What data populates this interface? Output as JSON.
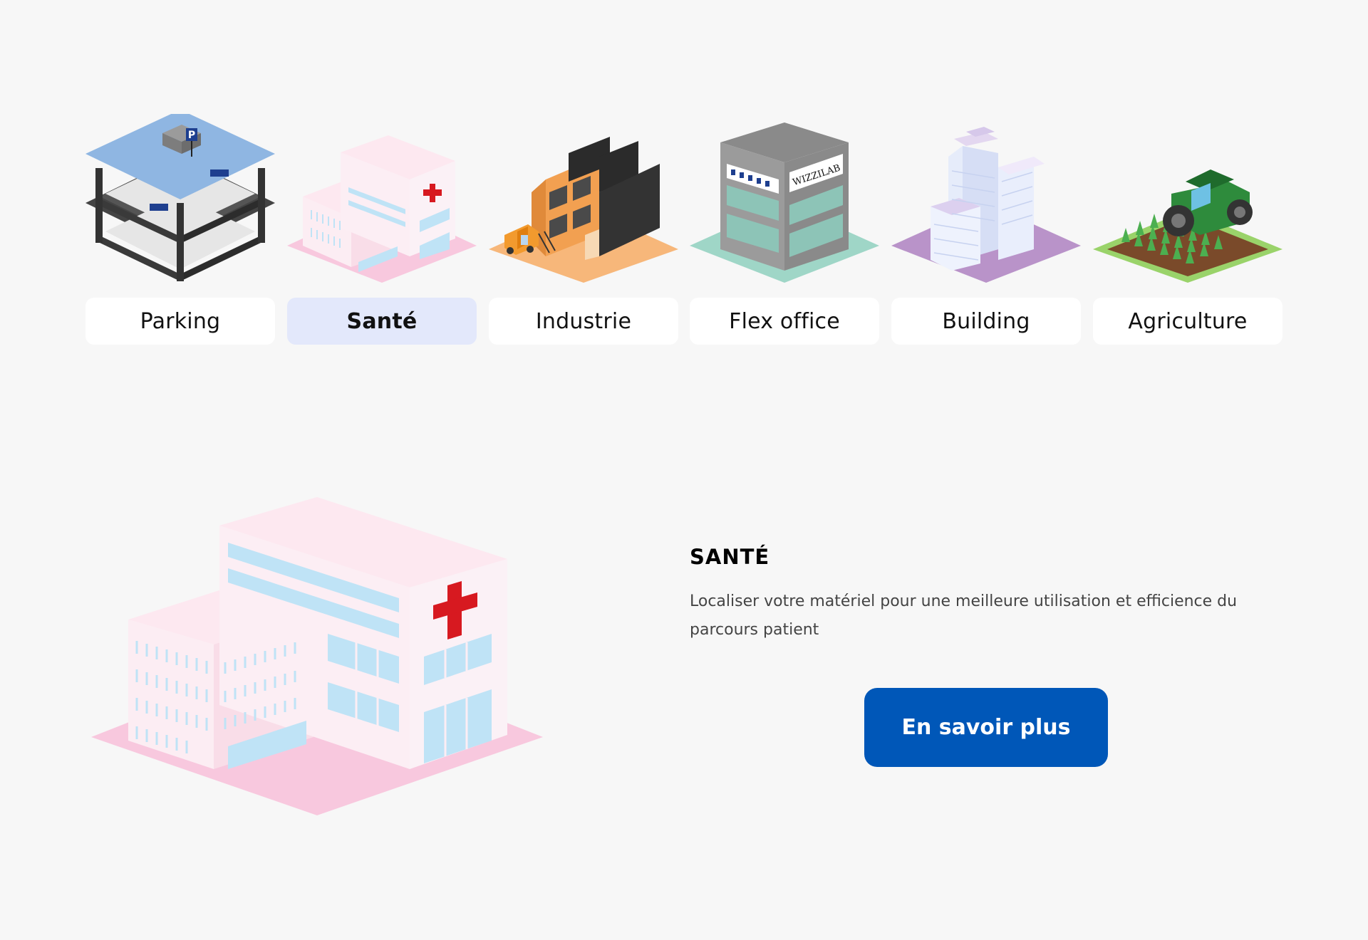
{
  "sectors": [
    {
      "label": "Parking",
      "icon": "parking-garage-icon",
      "active": false
    },
    {
      "label": "Santé",
      "icon": "hospital-icon",
      "active": true
    },
    {
      "label": "Industrie",
      "icon": "factory-icon",
      "active": false
    },
    {
      "label": "Flex office",
      "icon": "office-building-icon",
      "active": false,
      "sign": "WIZZILAB"
    },
    {
      "label": "Building",
      "icon": "skyscraper-icon",
      "active": false
    },
    {
      "label": "Agriculture",
      "icon": "tractor-field-icon",
      "active": false
    }
  ],
  "parking_sign": "P",
  "detail": {
    "title": "SANTÉ",
    "description": "Localiser votre matériel pour une meilleure utilisation et efficience du parcours patient",
    "cta_label": "En savoir plus",
    "image_icon": "hospital-large-icon"
  },
  "colors": {
    "background": "#f7f7f7",
    "active_tab": "#e3e8fb",
    "tab": "#ffffff",
    "cta": "#0057b8",
    "hospital_ground": "#f8c8de",
    "hospital_wall": "#fde8f0",
    "window": "#bfe3f6",
    "red_cross": "#d71920"
  }
}
